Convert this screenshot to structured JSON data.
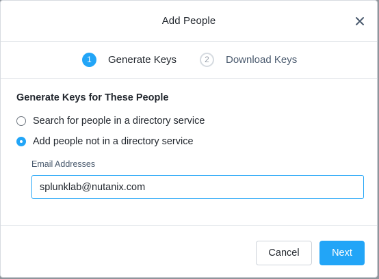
{
  "dialog": {
    "title": "Add People"
  },
  "steps": [
    {
      "number": "1",
      "label": "Generate Keys",
      "state": "active"
    },
    {
      "number": "2",
      "label": "Download Keys",
      "state": "inactive"
    }
  ],
  "section": {
    "title": "Generate Keys for These People"
  },
  "options": [
    {
      "label": "Search for people in a directory service",
      "selected": false
    },
    {
      "label": "Add people not in a directory service",
      "selected": true
    }
  ],
  "email": {
    "label": "Email Addresses",
    "value": "splunklab@nutanix.com"
  },
  "footer": {
    "cancel_label": "Cancel",
    "next_label": "Next"
  },
  "colors": {
    "accent": "#22a5f7",
    "text": "#22272e",
    "muted": "#4a5a6e"
  },
  "icons": {
    "close": "close-icon"
  }
}
